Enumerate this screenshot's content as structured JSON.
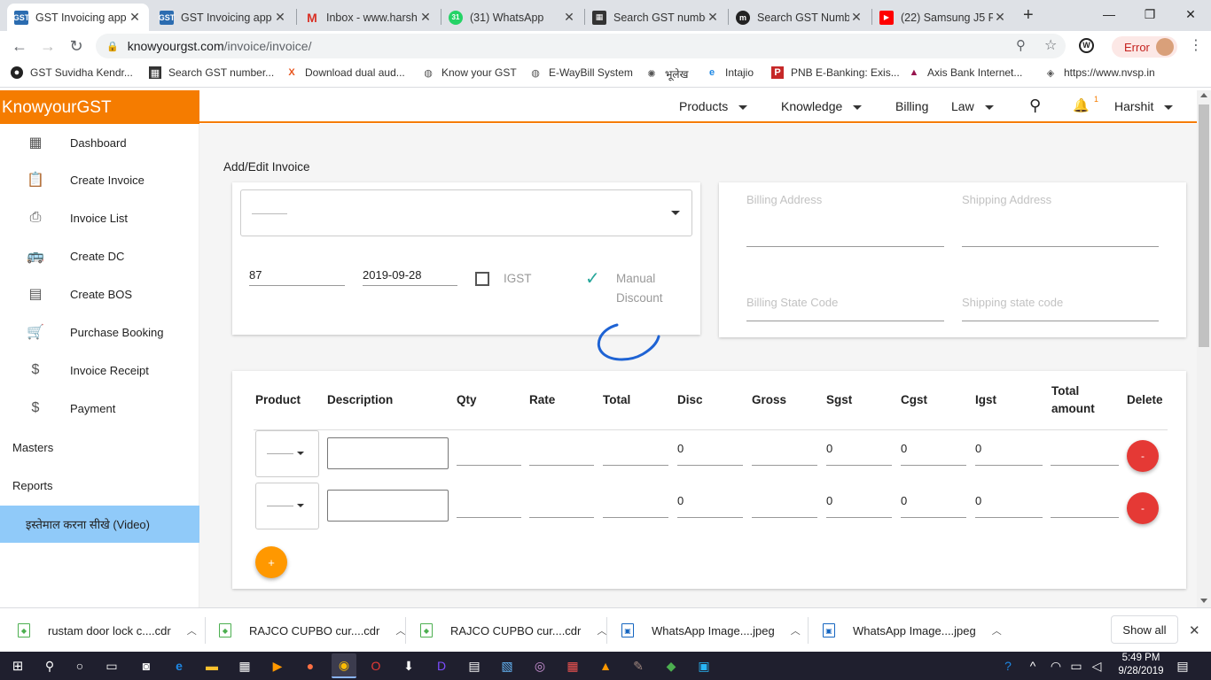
{
  "browser": {
    "tabs": [
      {
        "title": "GST Invoicing app",
        "icon": "gst-favicon",
        "active": true
      },
      {
        "title": "GST Invoicing app",
        "icon": "gst-favicon",
        "active": false
      },
      {
        "title": "Inbox - www.harsh",
        "icon": "gmail-favicon",
        "active": false
      },
      {
        "title": "(31) WhatsApp",
        "icon": "whatsapp-favicon",
        "active": false
      },
      {
        "title": "Search GST numbe",
        "icon": "search-gst-favicon",
        "active": false
      },
      {
        "title": "Search GST Numb",
        "icon": "m-favicon",
        "active": false
      },
      {
        "title": "(22) Samsung J5 P",
        "icon": "youtube-favicon",
        "active": false
      }
    ],
    "new_tab": "+",
    "window": {
      "minimize": "—",
      "maximize": "❐",
      "close": "✕"
    },
    "url_host": "knowyourgst.com",
    "url_path": "/invoice/invoice/",
    "error_label": "Error",
    "bookmarks": [
      "GST Suvidha Kendr...",
      "Search GST number...",
      "Download dual aud...",
      "Know your GST",
      "E-WayBill System",
      "भूलेख",
      "Intajio",
      "PNB E-Banking: Exis...",
      "Axis Bank Internet...",
      "https://www.nvsp.in"
    ]
  },
  "app": {
    "brand": "KnowyourGST",
    "nav": {
      "products": "Products",
      "knowledge": "Knowledge",
      "billing": "Billing",
      "law": "Law",
      "user": "Harshit",
      "notification_count": "1"
    },
    "sidebar": {
      "items": [
        {
          "label": "Dashboard",
          "icon": "dashboard-icon"
        },
        {
          "label": "Create Invoice",
          "icon": "clipboard-icon"
        },
        {
          "label": "Invoice List",
          "icon": "printer-icon"
        },
        {
          "label": "Create DC",
          "icon": "bus-icon"
        },
        {
          "label": "Create BOS",
          "icon": "document-icon"
        },
        {
          "label": "Purchase Booking",
          "icon": "cart-icon"
        },
        {
          "label": "Invoice Receipt",
          "icon": "dollar-icon"
        },
        {
          "label": "Payment",
          "icon": "dollar-icon"
        }
      ],
      "masters": "Masters",
      "reports": "Reports",
      "video": "इस्तेमाल करना सीखे (Video)"
    },
    "invoice": {
      "heading": "Add/Edit Invoice",
      "invoice_number": "87",
      "invoice_date": "2019-09-28",
      "igst_label": "IGST",
      "igst_checked": false,
      "manual_discount_label_1": "Manual",
      "manual_discount_label_2": "Discount",
      "manual_discount_checked": true,
      "billing_address_placeholder": "Billing Address",
      "shipping_address_placeholder": "Shipping Address",
      "billing_state_placeholder": "Billing State Code",
      "shipping_state_placeholder": "Shipping state code"
    },
    "table": {
      "headers": [
        "Product",
        "Description",
        "Qty",
        "Rate",
        "Total",
        "Disc",
        "Gross",
        "Sgst",
        "Cgst",
        "Igst",
        "Total",
        "amount",
        "Delete"
      ],
      "rows": [
        {
          "disc": "0",
          "sgst": "0",
          "cgst": "0",
          "igst": "0"
        },
        {
          "disc": "0",
          "sgst": "0",
          "cgst": "0",
          "igst": "0"
        }
      ],
      "delete_symbol": "-",
      "add_symbol": "+"
    }
  },
  "downloads": {
    "items": [
      "rustam door lock c....cdr",
      "RAJCO CUPBO cur....cdr",
      "RAJCO CUPBO cur....cdr",
      "WhatsApp Image....jpeg",
      "WhatsApp Image....jpeg"
    ],
    "show_all": "Show all"
  },
  "taskbar": {
    "time": "5:49 PM",
    "date": "9/28/2019"
  }
}
